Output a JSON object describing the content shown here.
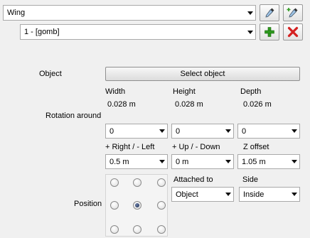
{
  "wing_select": {
    "value": "Wing"
  },
  "item_select": {
    "value": "1 - [gomb]"
  },
  "buttons": {
    "pick_icon": "eyedropper-icon",
    "pick_plus_icon": "eyedropper-plus-icon",
    "add_icon": "plus-icon",
    "delete_icon": "delete-x-icon",
    "select_object": "Select object"
  },
  "labels": {
    "object": "Object",
    "width": "Width",
    "height": "Height",
    "depth": "Depth",
    "rotation_around": "Rotation around",
    "right_left": "+ Right / - Left",
    "up_down": "+ Up / - Down",
    "z_offset": "Z offset",
    "attached_to": "Attached to",
    "side": "Side",
    "position": "Position"
  },
  "dimensions": {
    "width": "0.028 m",
    "height": "0.028 m",
    "depth": "0.026 m"
  },
  "rotation": {
    "x": "0",
    "y": "0",
    "z": "0"
  },
  "offsets": {
    "right_left": "0.5 m",
    "up_down": "0 m",
    "z_offset": "1.05 m"
  },
  "attached_to": {
    "value": "Object"
  },
  "side": {
    "value": "Inside"
  },
  "position_grid": {
    "selected_row": 1,
    "selected_col": 1
  },
  "colors": {
    "add_green": "#2e9a1f",
    "delete_red": "#d42020",
    "background": "#f0f0f0"
  }
}
